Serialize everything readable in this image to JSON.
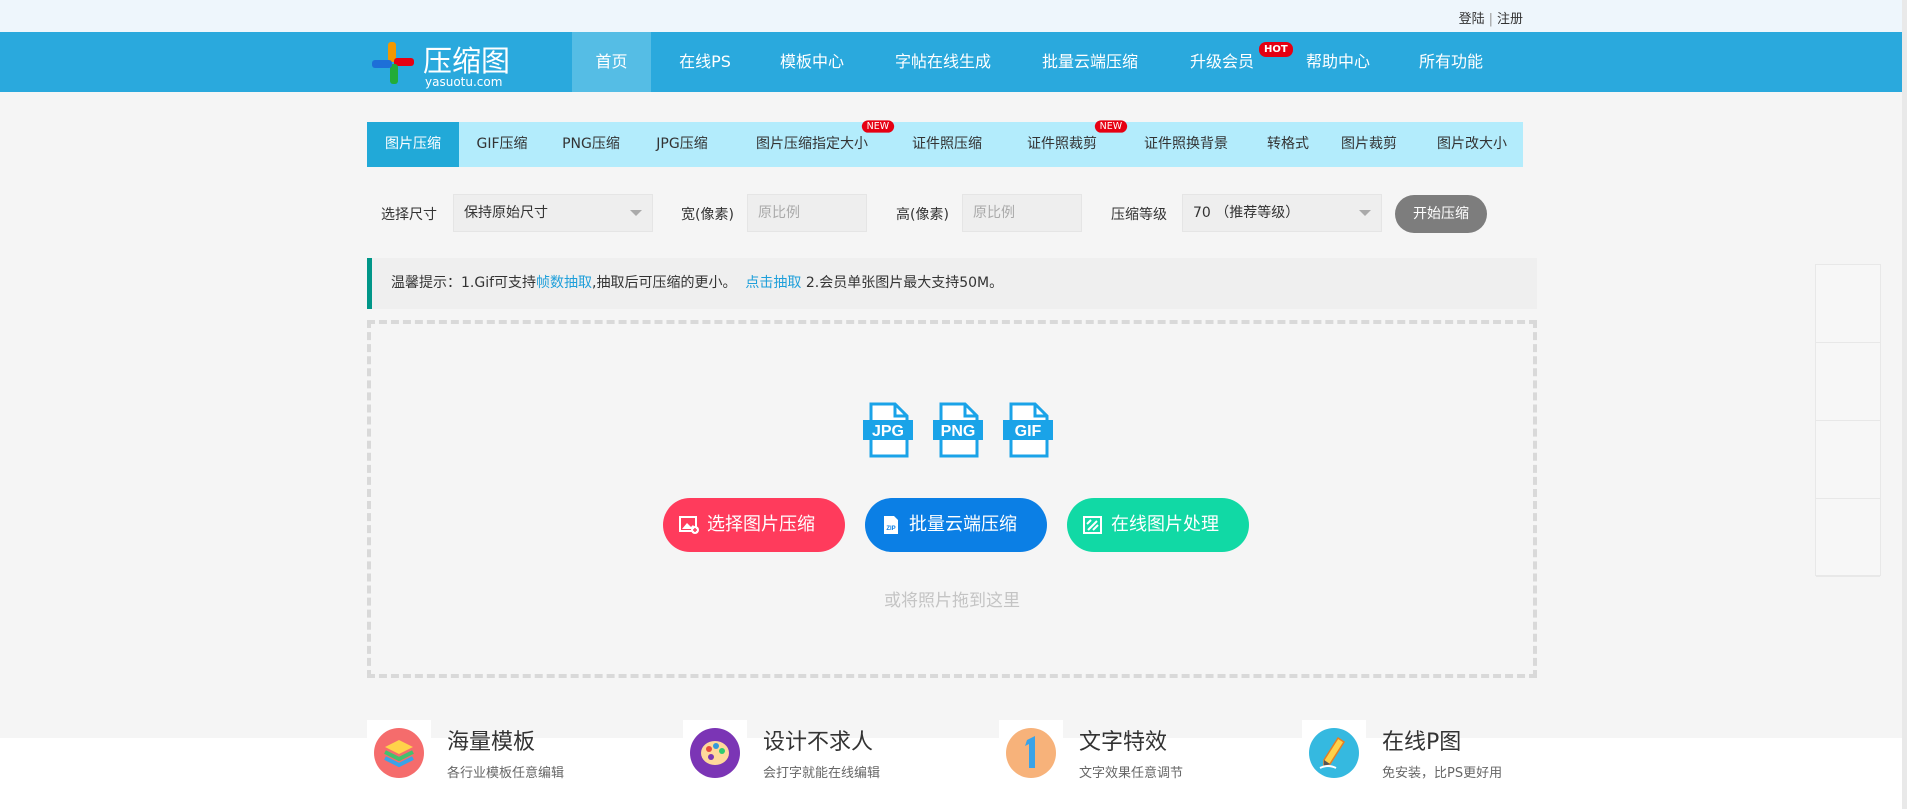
{
  "top_links": {
    "login": "登陆",
    "separator": "|",
    "register": "注册"
  },
  "logo": {
    "name": "压缩图",
    "domain": "yasuotu.com"
  },
  "nav": {
    "items": [
      "首页",
      "在线PS",
      "模板中心",
      "字帖在线生成",
      "批量云端压缩",
      "升级会员",
      "帮助中心",
      "所有功能"
    ],
    "hot_badge": "HOT"
  },
  "tabs": {
    "items": [
      "图片压缩",
      "GIF压缩",
      "PNG压缩",
      "JPG压缩",
      "图片压缩指定大小",
      "证件照压缩",
      "证件照裁剪",
      "证件照换背景",
      "转格式",
      "图片裁剪",
      "图片改大小"
    ],
    "new_badge": "NEW"
  },
  "options": {
    "size_label": "选择尺寸",
    "size_value": "保持原始尺寸",
    "width_label": "宽(像素)",
    "width_placeholder": "原比例",
    "height_label": "高(像素)",
    "height_placeholder": "原比例",
    "level_label": "压缩等级",
    "level_value": "70 （推荐等级）",
    "start_button": "开始压缩"
  },
  "tip": {
    "prefix": "温馨提示：1.Gif可支持",
    "link1": "帧数抽取",
    "middle": ",抽取后可压缩的更小。",
    "link2": "点击抽取",
    "suffix": "2.会员单张图片最大支持50M。"
  },
  "dropzone": {
    "file_types": [
      "JPG",
      "PNG",
      "GIF"
    ],
    "buttons": [
      "选择图片压缩",
      "批量云端压缩",
      "在线图片处理"
    ],
    "hint": "或将照片拖到这里"
  },
  "features": [
    {
      "title": "海量模板",
      "desc": "各行业模板任意编辑"
    },
    {
      "title": "设计不求人",
      "desc": "会打字就能在线编辑"
    },
    {
      "title": "文字特效",
      "desc": "文字效果任意调节"
    },
    {
      "title": "在线P图",
      "desc": "免安装，比PS更好用"
    }
  ],
  "colors": {
    "nav_bg": "#2aa9dd",
    "tab_bg": "#b3ecfc",
    "btn_red": "#ff3b5c",
    "btn_blue": "#0b7fe5",
    "btn_green": "#11d9a5",
    "badge_red": "#e60012"
  }
}
